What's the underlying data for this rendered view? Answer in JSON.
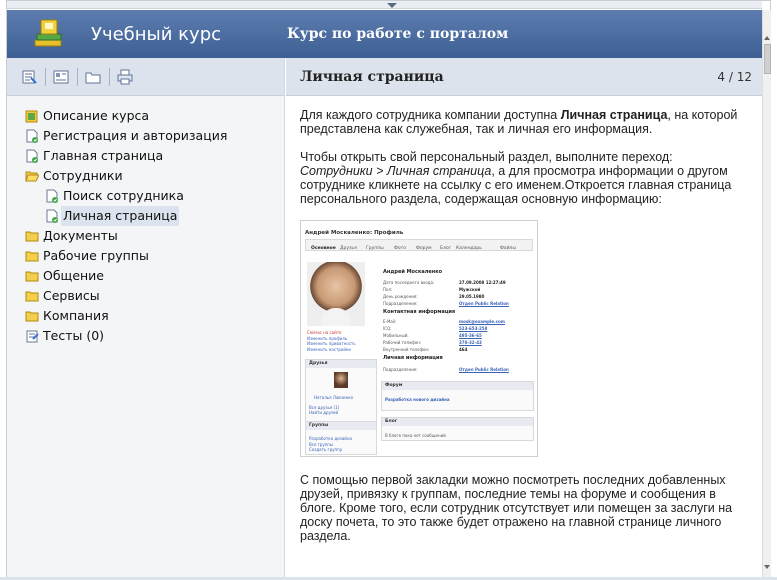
{
  "header": {
    "app_title": "Учебный курс",
    "course_title": "Курс по работе с порталом",
    "logo_icon": "book-stack-icon"
  },
  "toolbar": {
    "icons": [
      "contents-icon",
      "index-icon",
      "glossary-icon",
      "print-icon"
    ]
  },
  "sidebar": {
    "items": [
      {
        "label": "Описание курса",
        "icon": "course-description-icon",
        "level": 0
      },
      {
        "label": "Регистрация и авторизация",
        "icon": "lesson-icon",
        "level": 0
      },
      {
        "label": "Главная страница",
        "icon": "lesson-icon",
        "level": 0
      },
      {
        "label": "Сотрудники",
        "icon": "folder-open-icon",
        "level": 0
      },
      {
        "label": "Поиск сотрудника",
        "icon": "lesson-icon",
        "level": 1
      },
      {
        "label": "Личная страница",
        "icon": "lesson-icon",
        "level": 1,
        "selected": true
      },
      {
        "label": "Документы",
        "icon": "folder-icon",
        "level": 0
      },
      {
        "label": "Рабочие группы",
        "icon": "folder-icon",
        "level": 0
      },
      {
        "label": "Общение",
        "icon": "folder-icon",
        "level": 0
      },
      {
        "label": "Сервисы",
        "icon": "folder-icon",
        "level": 0
      },
      {
        "label": "Компания",
        "icon": "folder-icon",
        "level": 0
      },
      {
        "label": "Тесты (0)",
        "icon": "test-icon",
        "level": 0
      }
    ]
  },
  "page": {
    "title": "Личная страница",
    "counter": "4 / 12",
    "p1_pre": "Для каждого сотрудника компании доступна ",
    "p1_bold": "Личная страница",
    "p1_post": ", на которой представлена как служебная, так и личная его информация.",
    "p2_pre": "Чтобы открыть свой персональный раздел, выполните переход: ",
    "p2_italic": "Сотрудники > Личная страница",
    "p2_post": ", а для просмотра информации о другом сотруднике кликнете на ссылку с его именем.Откроется главная страница персонального раздела, содержащая основную информацию:",
    "p3": "С помощью первой закладки можно посмотреть последних добавленных друзей, привязку к группам, последние темы на форуме и сообщения в блоге. Кроме того, если сотрудник отсутствует или помещен за заслуги на доску почета, то это также будет отражено на главной странице личного раздела."
  },
  "screenshot": {
    "title": "Андрей Москаленко: Профиль",
    "tabs": [
      "Основное",
      "Друзья",
      "Группы",
      "Фото",
      "Форум",
      "Блог",
      "Календарь",
      "Файлы"
    ],
    "name": "Андрей Москаленко",
    "rows": [
      {
        "label": "Дата последнего входа:",
        "value": "27.09.2008 12:27:49"
      },
      {
        "label": "Пол:",
        "value": "Мужской"
      },
      {
        "label": "День рождения:",
        "value": "29.05.1980"
      },
      {
        "label": "Подразделение:",
        "value": "Отдел Public Relation"
      }
    ],
    "contacts_title": "Контактная информация",
    "contacts": [
      {
        "label": "E-Mail:",
        "value": "mosk@example.com"
      },
      {
        "label": "ICQ:",
        "value": "523-653-258"
      },
      {
        "label": "Мобильный:",
        "value": "495-36-65"
      },
      {
        "label": "Рабочий телефон:",
        "value": "370-32-43"
      },
      {
        "label": "Внутренний телефон:",
        "value": "464"
      }
    ],
    "personal_title": "Личная информация",
    "personal_label": "Подразделение:",
    "personal_value": "Отдел Public Relation",
    "status": "Сейчас на сайте",
    "links": [
      "Изменить профиль",
      "Изменить приватность",
      "Изменить настройки"
    ],
    "friends_title": "Друзья",
    "friend_name": "Наталья Лавчинко",
    "friends_link": "Все друзья (1)",
    "friends_link2": "Найти друзей",
    "groups_title": "Группы",
    "group_name": "Разработка дизайна",
    "groups_link": "Все группы",
    "groups_link2": "Создать группу",
    "forum_title": "Форум",
    "forum_topic": "Разработка нового дизайна",
    "blog_title": "Блог",
    "blog_text": "В блоге пока нет сообщений"
  }
}
